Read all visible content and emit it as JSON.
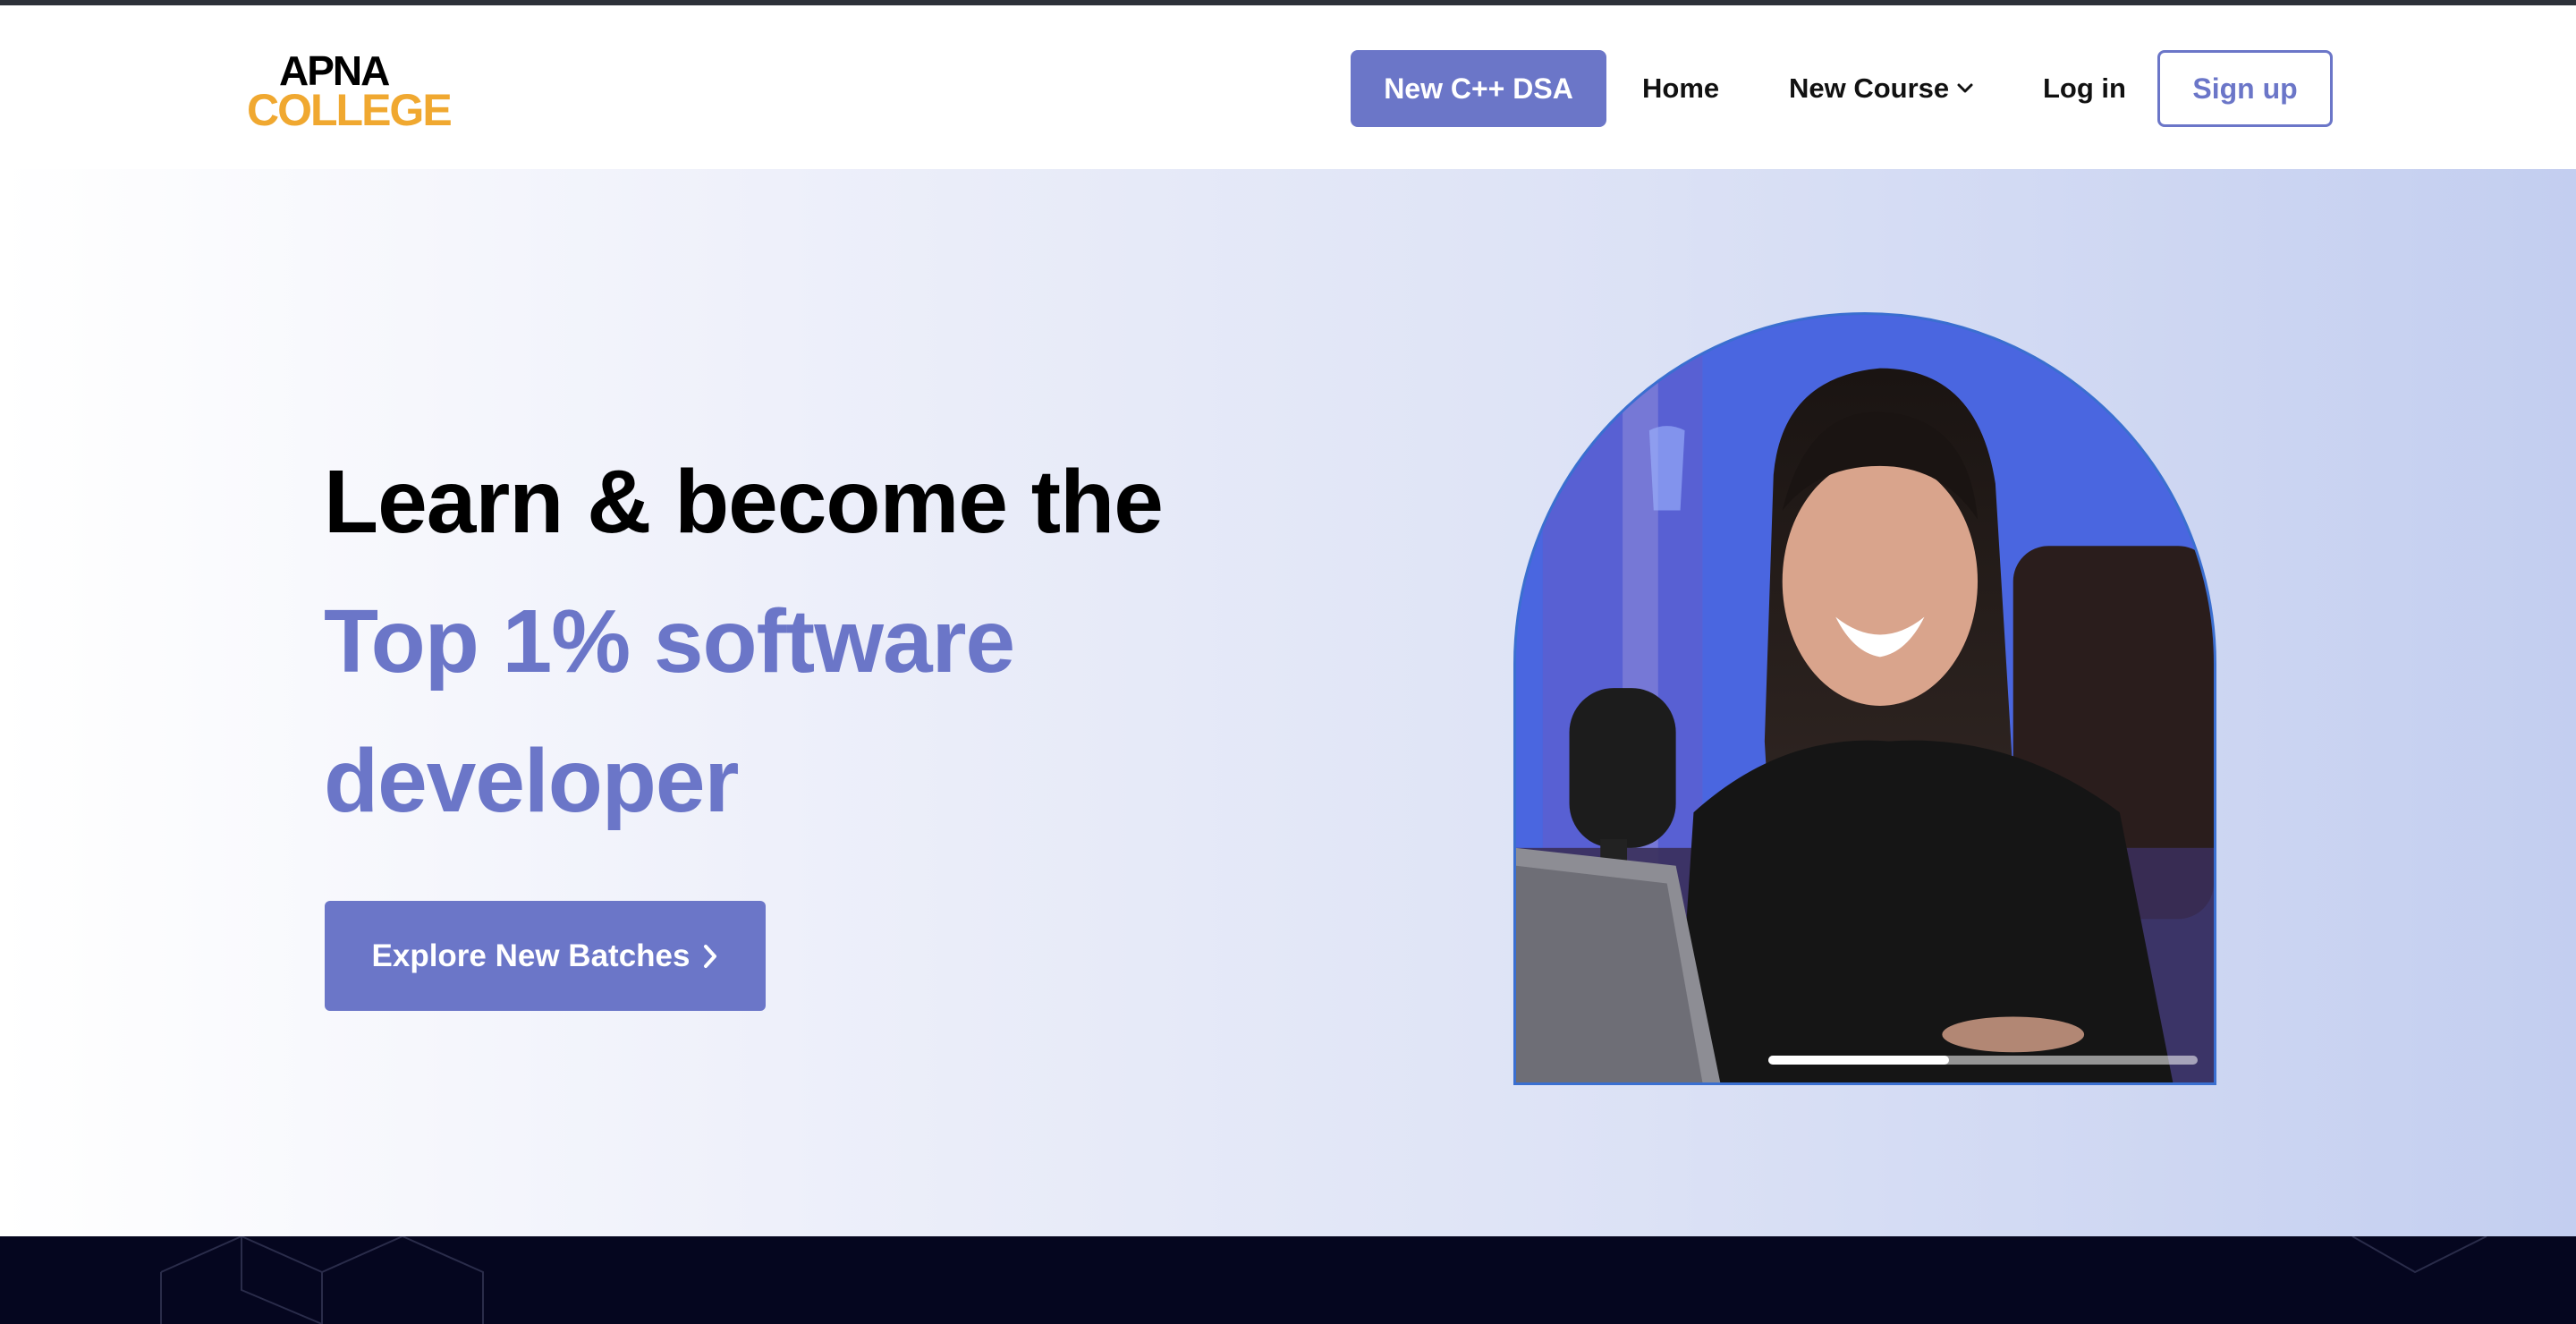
{
  "brand": {
    "logo_line1": "APNA",
    "logo_line2": "COLLEGE",
    "logo_dark": "#000000",
    "logo_accent": "#f0a830"
  },
  "nav": {
    "cta_label": "New C++ DSA",
    "home_label": "Home",
    "course_label": "New Course",
    "login_label": "Log in",
    "signup_label": "Sign up"
  },
  "hero": {
    "line1": "Learn & become the",
    "line2": "Top 1% software",
    "line3": "developer",
    "button_label": "Explore New Batches",
    "video_progress": 0.42
  },
  "colors": {
    "accent": "#6b76c8",
    "hero_gradient_end": "#c3cef0",
    "footer_band": "#05061f",
    "top_strip": "#2d3139"
  },
  "icons": {
    "course_dropdown": "chevron-down-icon",
    "cta_arrow": "chevron-right-icon"
  }
}
